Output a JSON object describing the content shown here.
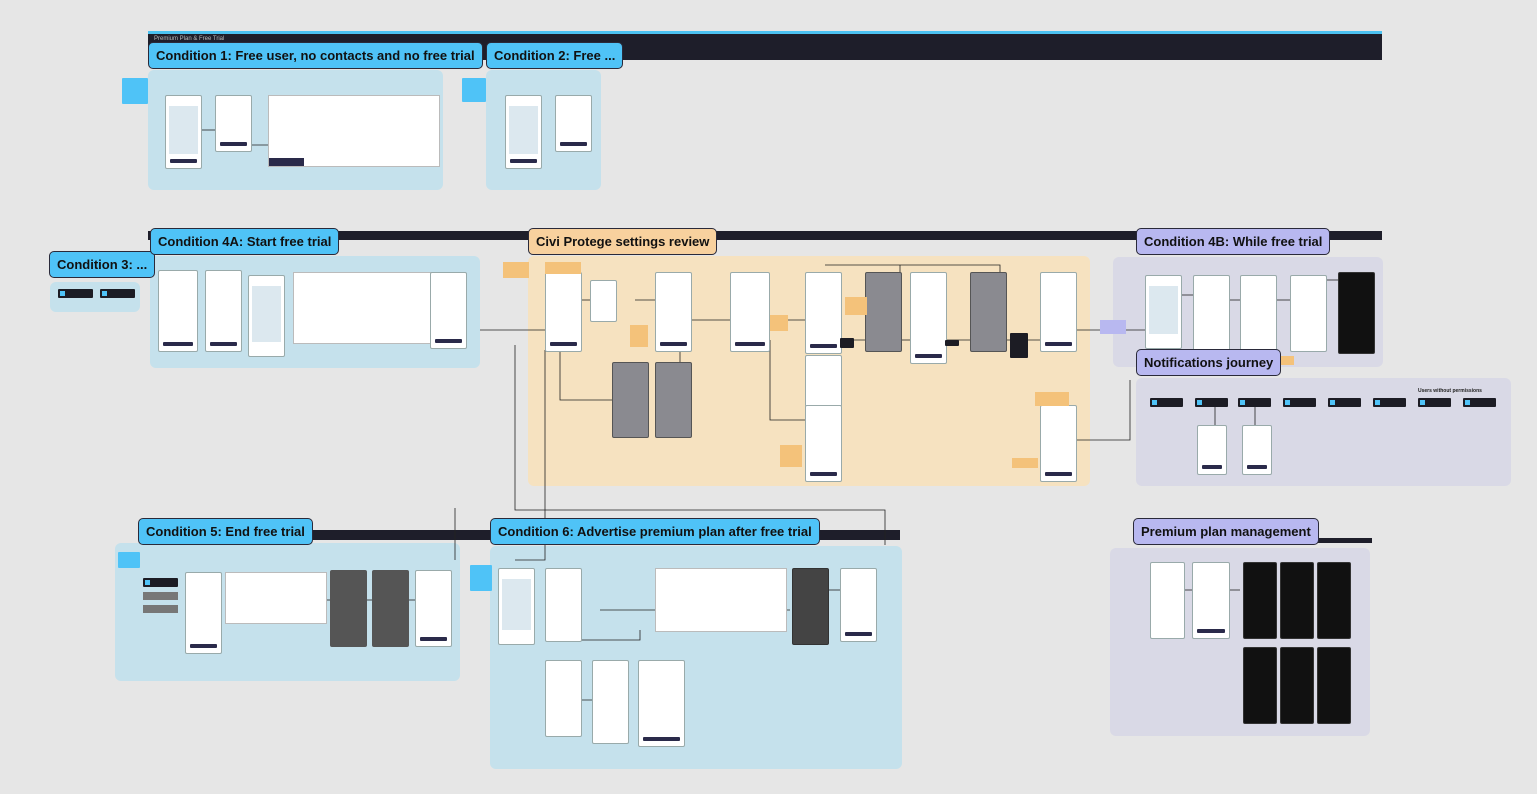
{
  "board": {
    "top_bar_title": "Premium Plan & Free Trial"
  },
  "sections": {
    "c1": "Condition 1: Free user, no contacts and no free trial",
    "c2": "Condition 2: Free ...",
    "c3": "Condition 3: ...",
    "c4a": "Condition 4A: Start free trial",
    "settings": "Civi Protege settings review",
    "c4b": "Condition 4B: While free trial",
    "notif": "Notifications journey",
    "c5": "Condition 5: End free trial",
    "c6": "Condition 6: Advertise premium plan after free trial",
    "premium": "Premium plan management"
  },
  "notes": {
    "users_without_permissions": "Users without permissions"
  },
  "colors": {
    "condition_label": "#4fc3f7",
    "settings_label": "#f8d19e",
    "journey_label": "#b8b8f0",
    "section_blue": "#c5e1ec",
    "section_orange": "#f6e2c0",
    "section_lavender": "#d9d9e6",
    "header_bar": "#1e1e2a"
  }
}
